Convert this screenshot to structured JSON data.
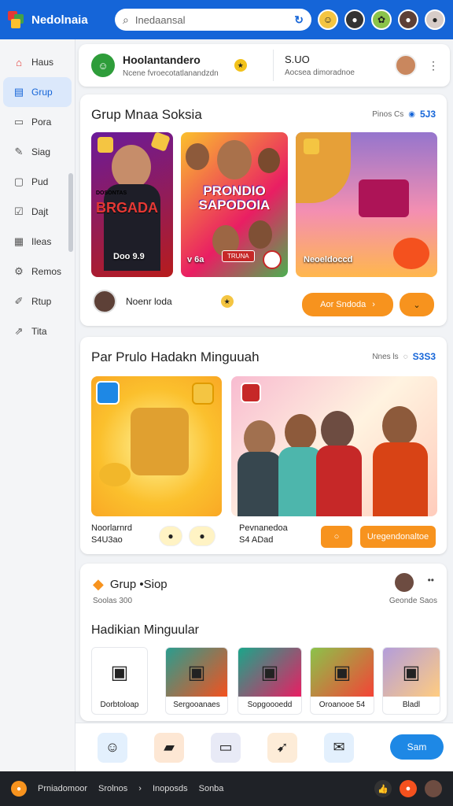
{
  "app": {
    "name": "Nedolnaia"
  },
  "search": {
    "placeholder": "Inedaansal"
  },
  "sidebar": {
    "items": [
      {
        "label": "Haus",
        "icon": "home-icon",
        "glyph": "⌂"
      },
      {
        "label": "Grup",
        "icon": "group-icon",
        "glyph": "▤"
      },
      {
        "label": "Pora",
        "icon": "document-icon",
        "glyph": "▭"
      },
      {
        "label": "Siag",
        "icon": "pen-icon",
        "glyph": "✎"
      },
      {
        "label": "Pud",
        "icon": "file-icon",
        "glyph": "▢"
      },
      {
        "label": "Dajt",
        "icon": "edit-icon",
        "glyph": "☑"
      },
      {
        "label": "Ileas",
        "icon": "folder-icon",
        "glyph": "▦"
      },
      {
        "label": "Remos",
        "icon": "settings-icon",
        "glyph": "⚙"
      },
      {
        "label": "Rtup",
        "icon": "brush-icon",
        "glyph": "✐"
      },
      {
        "label": "Tita",
        "icon": "share-icon",
        "glyph": "⇗"
      }
    ]
  },
  "profile": {
    "name": "Hoolantandero",
    "subtitle": "Ncene fvroecotatlanandzdn",
    "right_title": "S.UO",
    "right_subtitle": "Aocsea dimoradnoe"
  },
  "section1": {
    "title": "Grup Mnaa Soksia",
    "meta": "Pinos Cs",
    "count": "5J3",
    "thumbs": [
      {
        "caption": "BRGADA",
        "sub": "Doo 9.9",
        "sub_small": "DOSONTAS"
      },
      {
        "caption": "PRONDIO SAPODOIA",
        "sub": "v 6a",
        "tag": "TRUNA"
      },
      {
        "caption": "",
        "sub": "Neoeldoccd"
      }
    ],
    "footer_name": "Noenr loda",
    "action_label": "Aor Sndoda"
  },
  "section2": {
    "title": "Par Prulo Hadakn Minguuah",
    "meta": "Nnes ls",
    "count": "S3S3",
    "left_caption_1": "Noorlarnrd",
    "left_caption_2": "S4U3ao",
    "right_caption_1": "Pevnanedoa",
    "right_caption_2": "S4 ADad",
    "right_button": "Uregendonaltoe"
  },
  "section3": {
    "title": "Grup •Siop",
    "subtitle": "Soolas 300",
    "right_label": "Geonde Saos",
    "shelf_title": "Hadikian Minguular",
    "tiles": [
      {
        "label": "Dorbtoloap",
        "bg": "#ffffff"
      },
      {
        "label": "Sergooanaes",
        "bg": "#2a9d8f"
      },
      {
        "label": "Sopgoooedd",
        "bg": "#1aa68a"
      },
      {
        "label": "Oroanooe 54",
        "bg": "#8bc34a"
      },
      {
        "label": "Bladl",
        "bg": "#b39ddb"
      }
    ]
  },
  "dock": {
    "send_label": "Sam"
  },
  "taskbar": {
    "items": [
      "Prniadomoor",
      "Srolnos",
      "Inoposds",
      "Sonba"
    ]
  }
}
